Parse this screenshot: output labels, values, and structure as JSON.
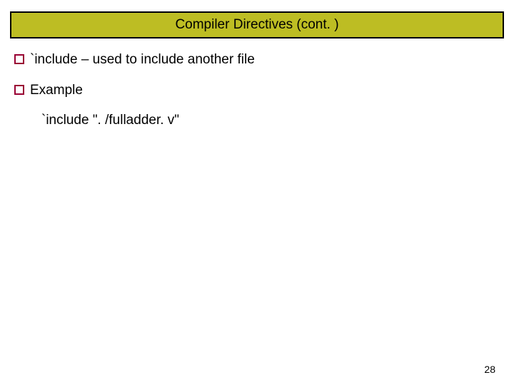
{
  "title": "Compiler Directives (cont. )",
  "bullets": [
    {
      "text": "`include – used to include another file"
    },
    {
      "text": "Example",
      "sub": "`include \". /fulladder. v\""
    }
  ],
  "pageNumber": "28"
}
